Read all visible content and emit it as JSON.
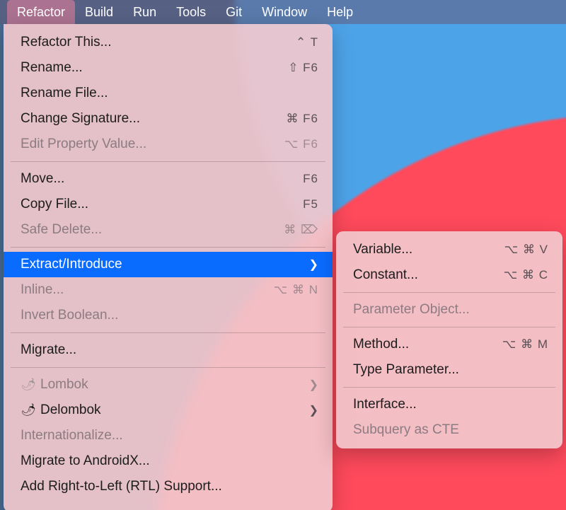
{
  "menubar": {
    "items": [
      {
        "label": "Refactor",
        "active": true
      },
      {
        "label": "Build"
      },
      {
        "label": "Run"
      },
      {
        "label": "Tools"
      },
      {
        "label": "Git"
      },
      {
        "label": "Window"
      },
      {
        "label": "Help"
      }
    ]
  },
  "refactor_menu": {
    "items": [
      {
        "label": "Refactor This...",
        "shortcut": "⌃ T"
      },
      {
        "label": "Rename...",
        "shortcut": "⇧ F6"
      },
      {
        "label": "Rename File..."
      },
      {
        "label": "Change Signature...",
        "shortcut": "⌘ F6"
      },
      {
        "label": "Edit Property Value...",
        "shortcut": "⌥ F6",
        "disabled": true
      },
      {
        "sep": true
      },
      {
        "label": "Move...",
        "shortcut": "F6"
      },
      {
        "label": "Copy File...",
        "shortcut": "F5"
      },
      {
        "label": "Safe Delete...",
        "shortcut": "⌘ ⌦",
        "disabled": true
      },
      {
        "sep": true
      },
      {
        "label": "Extract/Introduce",
        "submenu": true,
        "highlight": true
      },
      {
        "label": "Inline...",
        "shortcut": "⌥ ⌘ N",
        "disabled": true
      },
      {
        "label": "Invert Boolean...",
        "disabled": true
      },
      {
        "sep": true
      },
      {
        "label": "Migrate..."
      },
      {
        "sep": true
      },
      {
        "label": "Lombok",
        "submenu": true,
        "disabled": true,
        "icon": "chili-gray"
      },
      {
        "label": "Delombok",
        "submenu": true,
        "icon": "chili"
      },
      {
        "label": "Internationalize...",
        "disabled": true
      },
      {
        "label": "Migrate to AndroidX..."
      },
      {
        "label": "Add Right-to-Left (RTL) Support..."
      }
    ]
  },
  "extract_submenu": {
    "items": [
      {
        "label": "Variable...",
        "shortcut": "⌥ ⌘ V"
      },
      {
        "label": "Constant...",
        "shortcut": "⌥ ⌘ C"
      },
      {
        "sep": true
      },
      {
        "label": "Parameter Object...",
        "disabled": true
      },
      {
        "sep": true
      },
      {
        "label": "Method...",
        "shortcut": "⌥ ⌘ M"
      },
      {
        "label": "Type Parameter..."
      },
      {
        "sep": true
      },
      {
        "label": "Interface..."
      },
      {
        "label": "Subquery as CTE",
        "disabled": true
      }
    ]
  }
}
